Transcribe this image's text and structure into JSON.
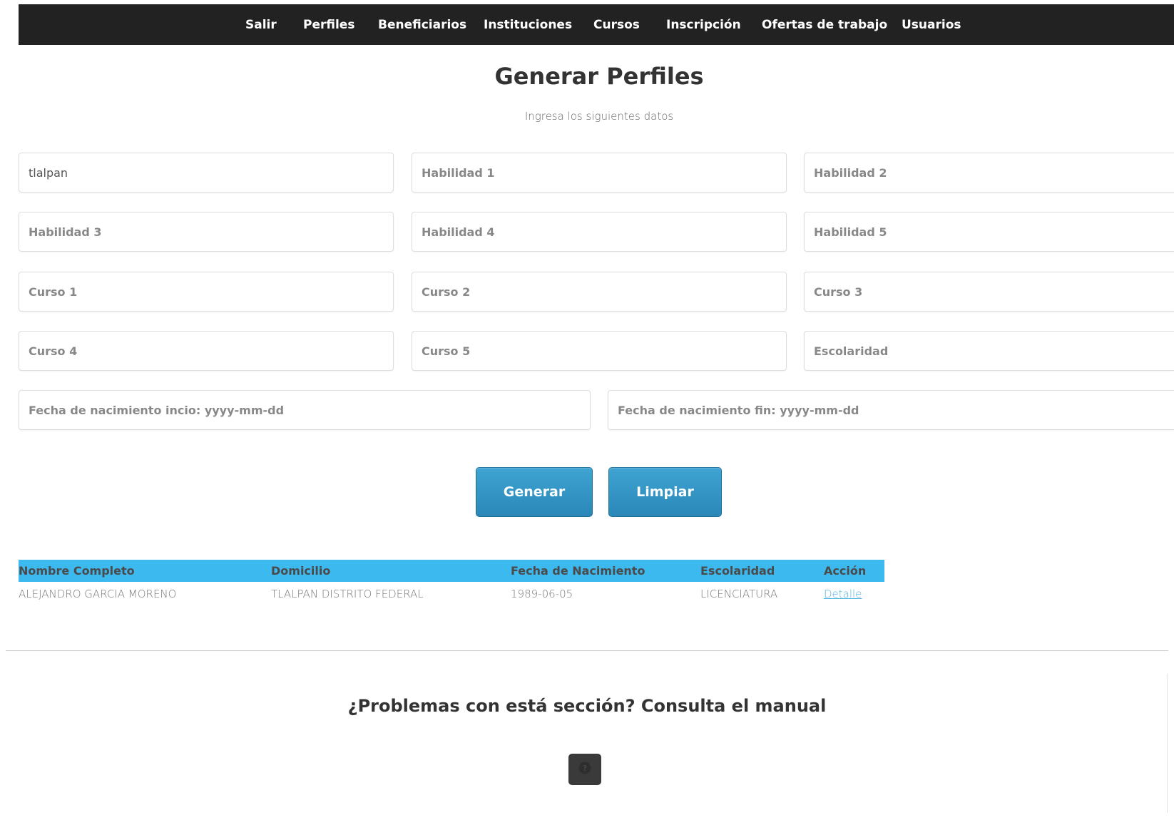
{
  "nav": {
    "items": [
      {
        "label": "Salir"
      },
      {
        "label": "Perfiles"
      },
      {
        "label": "Beneficiarios"
      },
      {
        "label": "Instituciones"
      },
      {
        "label": "Cursos"
      },
      {
        "label": "Inscripción"
      },
      {
        "label": "Ofertas de trabajo"
      },
      {
        "label": "Usuarios"
      }
    ]
  },
  "header": {
    "title": "Generar Perfiles",
    "subtitle": "Ingresa los siguientes datos"
  },
  "form": {
    "location": {
      "value": "tlalpan",
      "placeholder": ""
    },
    "habilidad1": {
      "value": "",
      "placeholder": "Habilidad 1"
    },
    "habilidad2": {
      "value": "",
      "placeholder": "Habilidad 2"
    },
    "habilidad3": {
      "value": "",
      "placeholder": "Habilidad 3"
    },
    "habilidad4": {
      "value": "",
      "placeholder": "Habilidad 4"
    },
    "habilidad5": {
      "value": "",
      "placeholder": "Habilidad 5"
    },
    "curso1": {
      "value": "",
      "placeholder": "Curso 1"
    },
    "curso2": {
      "value": "",
      "placeholder": "Curso 2"
    },
    "curso3": {
      "value": "",
      "placeholder": "Curso 3"
    },
    "curso4": {
      "value": "",
      "placeholder": "Curso 4"
    },
    "curso5": {
      "value": "",
      "placeholder": "Curso 5"
    },
    "escolaridad": {
      "value": "",
      "placeholder": "Escolaridad"
    },
    "fecha_inicio": {
      "value": "",
      "placeholder": "Fecha de nacimiento incio: yyyy-mm-dd"
    },
    "fecha_fin": {
      "value": "",
      "placeholder": "Fecha de nacimiento fin: yyyy-mm-dd"
    },
    "generate_label": "Generar",
    "clear_label": "Limpiar"
  },
  "results": {
    "headers": [
      "Nombre Completo",
      "Domicilio",
      "Fecha de Nacimiento",
      "Escolaridad",
      "Acción"
    ],
    "rows": [
      [
        "ALEJANDRO GARCIA MORENO",
        "TLALPAN DISTRITO FEDERAL",
        "1989-06-05",
        "LICENCIATURA",
        "Detalle"
      ]
    ]
  },
  "help": {
    "title": "¿Problemas con está sección? Consulta el manual",
    "icon": "question-icon"
  },
  "colors": {
    "navbar_bg": "#222222",
    "table_header_bg": "#3cb9ee",
    "button_bg": "#2a87b8",
    "link": "#4fb3e0"
  }
}
